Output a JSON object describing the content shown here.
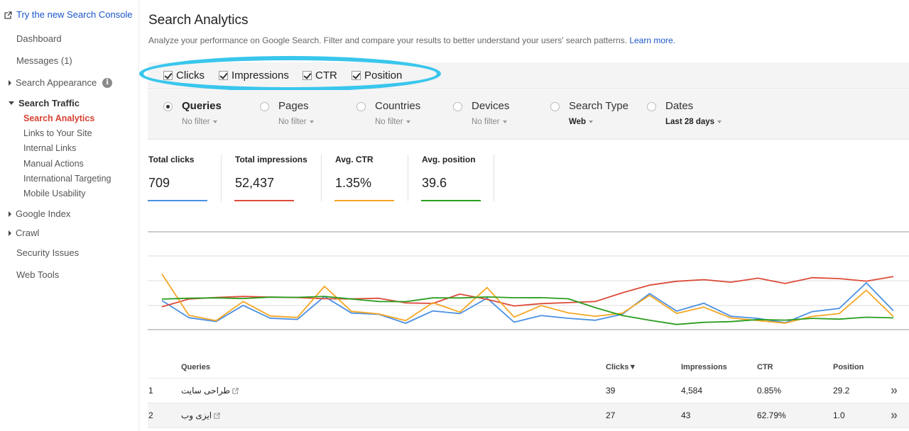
{
  "sidebar": {
    "try_new": "Try the new Search Console",
    "dashboard": "Dashboard",
    "messages": "Messages (1)",
    "search_appearance": "Search Appearance",
    "search_traffic": "Search Traffic",
    "search_traffic_items": [
      "Search Analytics",
      "Links to Your Site",
      "Internal Links",
      "Manual Actions",
      "International Targeting",
      "Mobile Usability"
    ],
    "google_index": "Google Index",
    "crawl": "Crawl",
    "security_issues": "Security Issues",
    "web_tools": "Web Tools"
  },
  "header": {
    "title": "Search Analytics",
    "subtitle": "Analyze your performance on Google Search. Filter and compare your results to better understand your users' search patterns.",
    "learn_more": "Learn more."
  },
  "metrics": [
    {
      "label": "Clicks",
      "checked": true
    },
    {
      "label": "Impressions",
      "checked": true
    },
    {
      "label": "CTR",
      "checked": true
    },
    {
      "label": "Position",
      "checked": true
    }
  ],
  "filters": [
    {
      "label": "Queries",
      "value": "No filter",
      "selected": true
    },
    {
      "label": "Pages",
      "value": "No filter",
      "selected": false
    },
    {
      "label": "Countries",
      "value": "No filter",
      "selected": false
    },
    {
      "label": "Devices",
      "value": "No filter",
      "selected": false
    },
    {
      "label": "Search Type",
      "value": "Web",
      "selected": false
    },
    {
      "label": "Dates",
      "value": "Last 28 days",
      "selected": false
    }
  ],
  "totals": [
    {
      "label": "Total clicks",
      "value": "709",
      "color": "#4a90e2"
    },
    {
      "label": "Total impressions",
      "value": "52,437",
      "color": "#dd4b39"
    },
    {
      "label": "Avg. CTR",
      "value": "1.35%",
      "color": "#f5a623"
    },
    {
      "label": "Avg. position",
      "value": "39.6",
      "color": "#2a9d1f"
    }
  ],
  "chart_data": {
    "type": "line",
    "x": [
      1,
      2,
      3,
      4,
      5,
      6,
      7,
      8,
      9,
      10,
      11,
      12,
      13,
      14,
      15,
      16,
      17,
      18,
      19,
      20,
      21,
      22,
      23,
      24,
      25,
      26,
      27,
      28,
      29,
      30,
      31,
      32,
      33,
      34,
      35,
      36,
      37,
      38,
      39,
      40
    ],
    "series": [
      {
        "name": "Clicks",
        "color": "#4a90e2",
        "values": [
          29.7,
          12.2,
          8.3,
          24.8,
          11.7,
          10.4,
          33.9,
          16.9,
          15.7,
          6.5,
          19.1,
          16.4,
          32.2,
          7.6,
          14.4,
          11.6,
          9.6,
          15.8,
          36.9,
          18.9,
          27.0,
          13.7,
          11.5,
          7.0,
          18.4,
          21.7,
          47.8,
          19.3
        ]
      },
      {
        "name": "Impressions",
        "color": "#dd4b39",
        "values": [
          23.3,
          31.3,
          32.9,
          33.9,
          33.2,
          32.8,
          31.6,
          31.4,
          32.1,
          27.3,
          26.8,
          36.3,
          31.0,
          24.2,
          26.6,
          27.6,
          28.8,
          37.7,
          45.5,
          49.4,
          51.1,
          48.5,
          52.6,
          47.2,
          53.1,
          52.2,
          49.6,
          54.3
        ]
      },
      {
        "name": "CTR",
        "color": "#f5a623",
        "values": [
          56.9,
          14.6,
          9.1,
          28.8,
          13.9,
          12.5,
          44.3,
          18.7,
          16.0,
          9.3,
          27.5,
          17.9,
          43.0,
          12.8,
          24.6,
          17.1,
          13.7,
          16.8,
          35.1,
          16.6,
          23.0,
          12.0,
          9.3,
          6.7,
          13.5,
          16.4,
          40.2,
          13.4
        ]
      },
      {
        "name": "Position",
        "color": "#2a9d1f",
        "values": [
          31.2,
          32.1,
          32.5,
          31.8,
          33.2,
          33.0,
          34.0,
          31.3,
          28.8,
          28.6,
          32.5,
          32.4,
          33.4,
          32.6,
          32.7,
          31.5,
          22.5,
          14.4,
          9.6,
          5.3,
          7.5,
          8.2,
          10.3,
          9.7,
          11.5,
          10.7,
          12.7,
          12.0
        ]
      }
    ]
  },
  "table": {
    "headers": [
      "Queries",
      "Clicks▼",
      "Impressions",
      "CTR",
      "Position"
    ],
    "rows": [
      {
        "idx": "1",
        "query": "طراحی سایت",
        "clicks": "39",
        "impressions": "4,584",
        "ctr": "0.85%",
        "position": "29.2"
      },
      {
        "idx": "2",
        "query": "ایزی وب",
        "clicks": "27",
        "impressions": "43",
        "ctr": "62.79%",
        "position": "1.0"
      }
    ]
  }
}
